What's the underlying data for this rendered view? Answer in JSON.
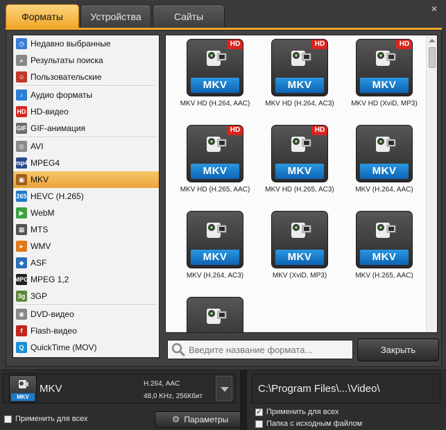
{
  "tabs": [
    {
      "label": "Форматы",
      "active": true
    },
    {
      "label": "Устройства",
      "active": false
    },
    {
      "label": "Сайты",
      "active": false
    }
  ],
  "close_icon": "close-icon",
  "sidebar": {
    "items": [
      {
        "label": "Недавно выбранные",
        "icon": "recent-icon",
        "color": "#3b7bd4"
      },
      {
        "label": "Результаты поиска",
        "icon": "search-icon",
        "color": "#888888"
      },
      {
        "label": "Пользовательские",
        "icon": "user-icon",
        "color": "#c0392b"
      },
      {
        "label": "Аудио форматы",
        "icon": "music-note-icon",
        "color": "#2a7fd4"
      },
      {
        "label": "HD-видео",
        "icon": "hd-icon",
        "color": "#d8261e"
      },
      {
        "label": "GIF-анимация",
        "icon": "gif-icon",
        "color": "#6d6d6d"
      },
      {
        "label": "AVI",
        "icon": "film-reel-icon",
        "color": "#8a8a8a"
      },
      {
        "label": "MPEG4",
        "icon": "mp4-icon",
        "color": "#2b4b8a"
      },
      {
        "label": "MKV",
        "icon": "mkv-icon",
        "color": "#a0601c",
        "selected": true
      },
      {
        "label": "HEVC (H.265)",
        "icon": "hevc-icon",
        "color": "#1f78c8"
      },
      {
        "label": "WebM",
        "icon": "webm-icon",
        "color": "#3aa241"
      },
      {
        "label": "MTS",
        "icon": "mts-icon",
        "color": "#555555"
      },
      {
        "label": "WMV",
        "icon": "wmv-icon",
        "color": "#e07a1a"
      },
      {
        "label": "ASF",
        "icon": "asf-icon",
        "color": "#2b6fb8"
      },
      {
        "label": "MPEG 1,2",
        "icon": "mpeg-icon",
        "color": "#222222"
      },
      {
        "label": "3GP",
        "icon": "3gp-icon",
        "color": "#5a8a3a"
      },
      {
        "label": "DVD-видео",
        "icon": "dvd-icon",
        "color": "#888888"
      },
      {
        "label": "Flash-видео",
        "icon": "flash-icon",
        "color": "#c0271f"
      },
      {
        "label": "QuickTime (MOV)",
        "icon": "quicktime-icon",
        "color": "#1a8fd8"
      }
    ]
  },
  "grid": {
    "badge_text": "MKV",
    "hd_text": "HD",
    "cards": [
      {
        "label": "MKV HD (H.264, AAC)",
        "hd": true
      },
      {
        "label": "MKV HD (H.264, AC3)",
        "hd": true
      },
      {
        "label": "MKV HD (XviD, MP3)",
        "hd": true
      },
      {
        "label": "MKV HD (H.265, AAC)",
        "hd": true
      },
      {
        "label": "MKV HD (H.265, AC3)",
        "hd": true
      },
      {
        "label": "MKV (H.264, AAC)",
        "hd": false
      },
      {
        "label": "MKV (H.264, AC3)",
        "hd": false
      },
      {
        "label": "MKV (XviD, MP3)",
        "hd": false
      },
      {
        "label": "MKV (H.265, AAC)",
        "hd": false
      },
      {
        "label": "",
        "hd": false
      }
    ]
  },
  "search": {
    "placeholder": "Введите название формата..."
  },
  "close_button": "Закрыть",
  "output_format": {
    "name": "MKV",
    "badge": "MKV",
    "codec": "H.264, AAC",
    "audio": "48,0 KHz, 256Кбит"
  },
  "apply_all_left": "Применить для всех",
  "params_button": "Параметры",
  "output_path": "C:\\Program Files\\...\\Video\\",
  "apply_all_right": "Применить для всех",
  "source_folder": "Папка с исходным файлом",
  "colors": {
    "accent": "#f0a829",
    "mkv_blue": "#1a79cc",
    "hd_red": "#d8261e"
  }
}
